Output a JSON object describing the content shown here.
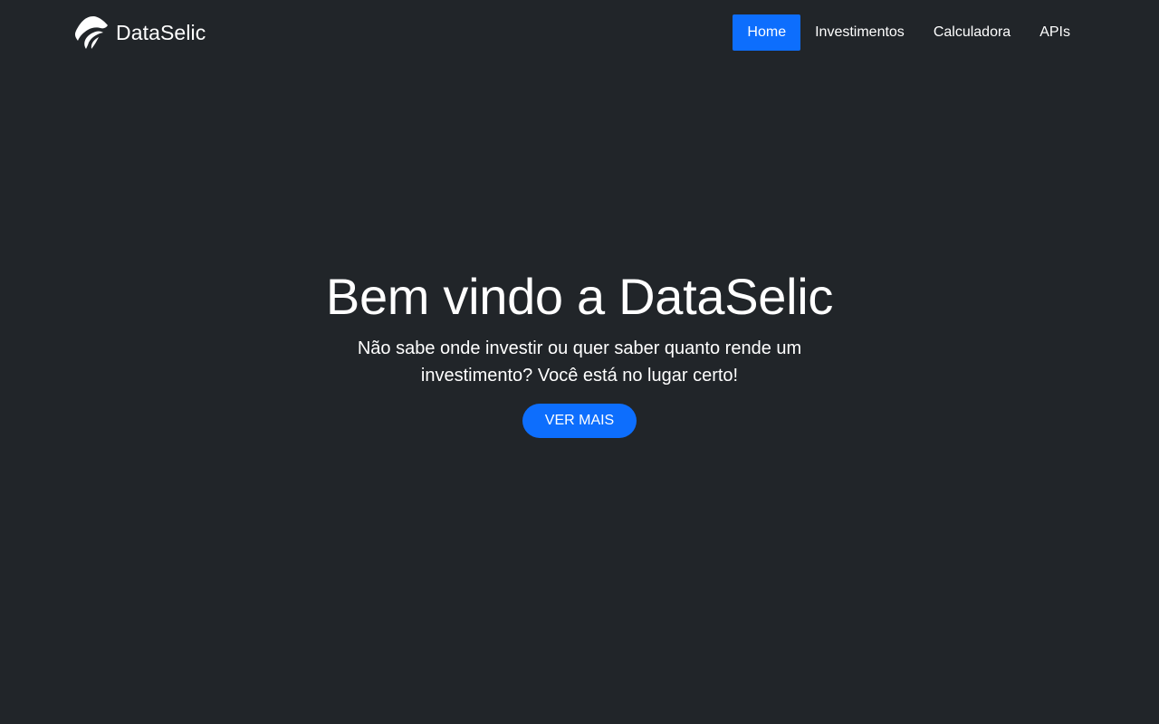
{
  "brand": {
    "name": "DataSelic",
    "logo_icon": "bird-leaf-logo-icon"
  },
  "nav": {
    "items": [
      {
        "label": "Home",
        "active": true
      },
      {
        "label": "Investimentos",
        "active": false
      },
      {
        "label": "Calculadora",
        "active": false
      },
      {
        "label": "APIs",
        "active": false
      }
    ]
  },
  "hero": {
    "title": "Bem vindo a DataSelic",
    "subtitle": "Não sabe onde investir ou quer saber quanto rende um investimento? Você está no lugar certo!",
    "cta_label": "VER MAIS"
  },
  "colors": {
    "background": "#212529",
    "accent": "#0d6efd",
    "text": "#ffffff"
  }
}
